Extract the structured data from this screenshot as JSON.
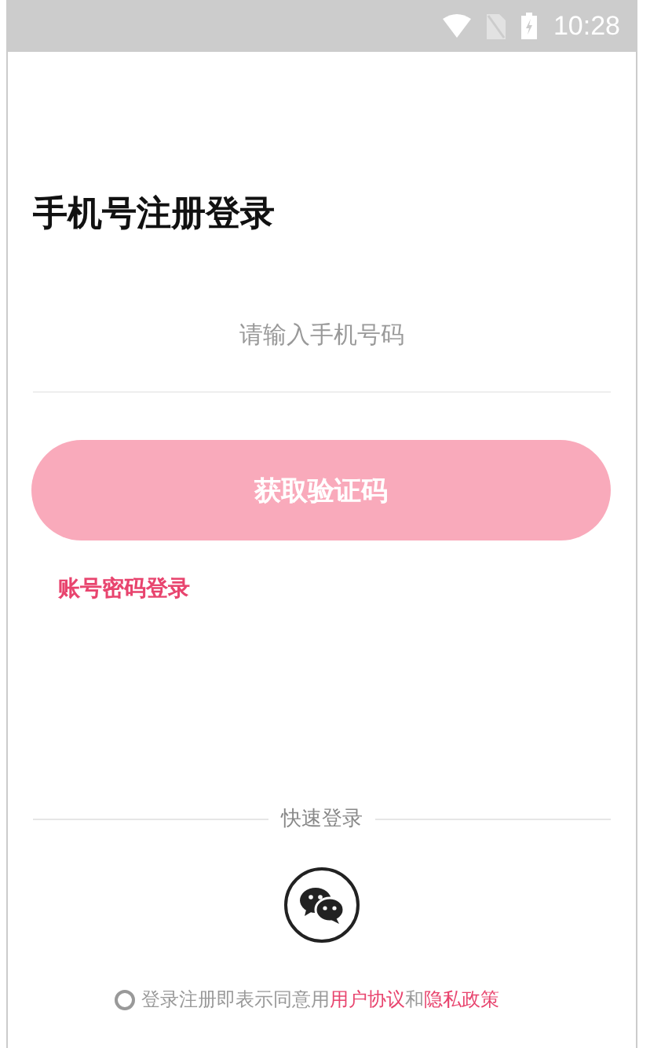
{
  "status_bar": {
    "time": "10:28"
  },
  "title": "手机号注册登录",
  "phone_field": {
    "placeholder": "请输入手机号码"
  },
  "get_code_button": {
    "label": "获取验证码",
    "disabled": true
  },
  "password_login_link": "账号密码登录",
  "quick_login": {
    "label": "快速登录"
  },
  "agreement": {
    "checked": false,
    "text": "登录注册即表示同意用",
    "terms_link": "用户协议",
    "conjunction": "和",
    "privacy_link": "隐私政策"
  }
}
